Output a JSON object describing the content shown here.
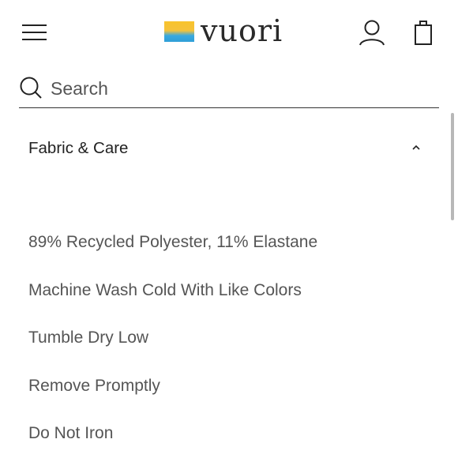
{
  "header": {
    "menu_icon": "hamburger-menu-icon",
    "logo_text": "vuori",
    "account_icon": "user-icon",
    "bag_icon": "shopping-bag-icon"
  },
  "search": {
    "placeholder": "Search",
    "value": "",
    "icon": "search-icon"
  },
  "accordion": {
    "title": "Fabric & Care",
    "state": "expanded",
    "chevron_icon": "chevron-up-icon",
    "items": [
      "89% Recycled Polyester, 11% Elastane",
      "Machine Wash Cold With Like Colors",
      "Tumble Dry Low",
      "Remove Promptly",
      "Do Not Iron"
    ]
  },
  "colors": {
    "logo_yellow": "#f8c32c",
    "logo_blue": "#39a9e0",
    "text_primary": "#222222",
    "text_secondary": "#555555"
  }
}
